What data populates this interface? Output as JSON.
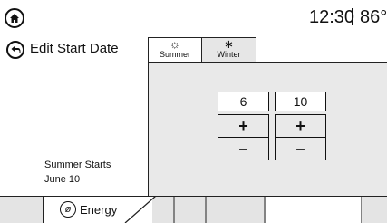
{
  "status_bar": {
    "time": "12:30",
    "temperature": "86°"
  },
  "header": {
    "title": "Edit Start Date"
  },
  "tabs": [
    {
      "label": "Summer",
      "icon": "sun-icon",
      "selected": true
    },
    {
      "label": "Winter",
      "icon": "snowflake-icon",
      "selected": false
    }
  ],
  "date_editor": {
    "month_value": "6",
    "day_value": "10",
    "plus_symbol": "+",
    "minus_symbol": "–"
  },
  "info": {
    "label": "Summer Starts",
    "value": "June 10"
  },
  "bottom_bar": {
    "energy_label": "Energy"
  },
  "colors": {
    "panel_bg": "#e9e9e9",
    "inactive_tab": "#e6e6e6",
    "bottom_bar": "#e4e4e4"
  }
}
